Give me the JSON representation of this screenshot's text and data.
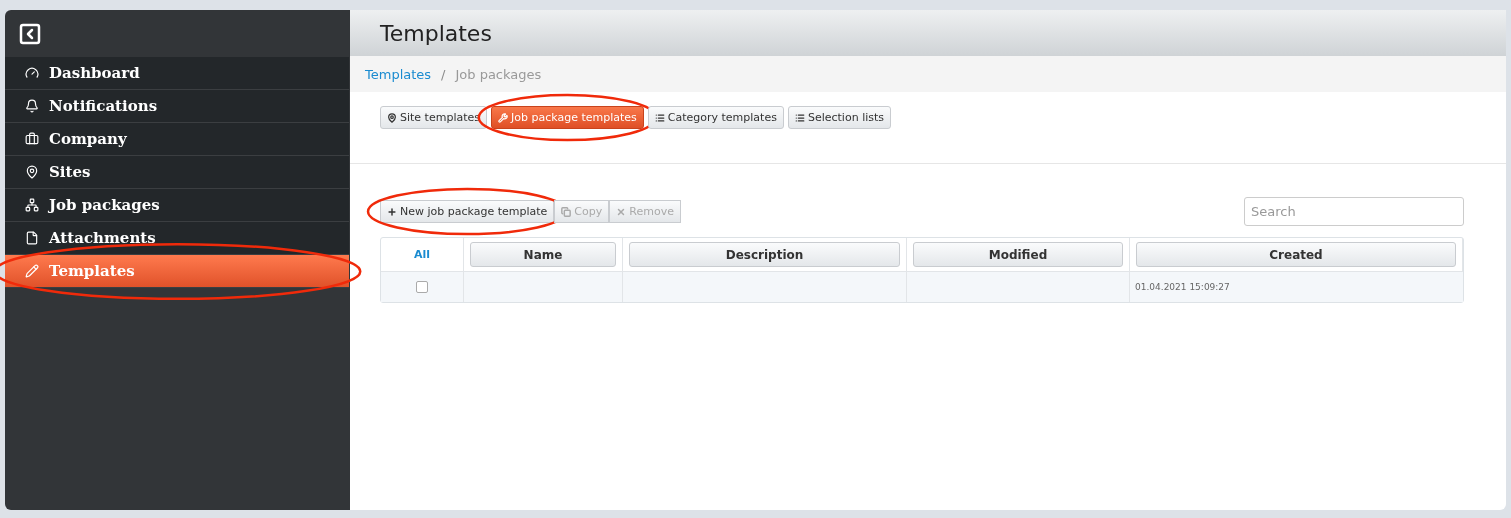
{
  "sidebar": {
    "items": [
      {
        "label": "Dashboard",
        "selected": false,
        "highlighted": false
      },
      {
        "label": "Notifications",
        "selected": false,
        "highlighted": false
      },
      {
        "label": "Company",
        "selected": false,
        "highlighted": false
      },
      {
        "label": "Sites",
        "selected": false,
        "highlighted": false
      },
      {
        "label": "Job packages",
        "selected": false,
        "highlighted": false
      },
      {
        "label": "Attachments",
        "selected": false,
        "highlighted": false
      },
      {
        "label": "Templates",
        "selected": true,
        "highlighted": true
      }
    ]
  },
  "header": {
    "title": "Templates"
  },
  "breadcrumb": [
    {
      "label": "Templates",
      "kind": "link"
    },
    {
      "label": "/",
      "kind": "separator"
    },
    {
      "label": "Job packages",
      "kind": "current"
    }
  ],
  "tabs": [
    {
      "label": "Site templates",
      "selected": false,
      "highlighted": false
    },
    {
      "label": "Job package templates",
      "selected": true,
      "highlighted": true
    },
    {
      "label": "Category templates",
      "selected": false,
      "highlighted": false
    },
    {
      "label": "Selection lists",
      "selected": false,
      "highlighted": false
    }
  ],
  "toolbar": [
    {
      "label": "New job package template",
      "disabled": false,
      "highlighted": true
    },
    {
      "label": "Copy",
      "disabled": true,
      "highlighted": false
    },
    {
      "label": "Remove",
      "disabled": true,
      "highlighted": false
    }
  ],
  "search": {
    "placeholder": "Search"
  },
  "table": {
    "select_all": "All",
    "columns": [
      "Name",
      "Description",
      "Modified",
      "Created"
    ],
    "rows": [
      {
        "checked": false,
        "created": "01.04.2021 15:09:27"
      }
    ]
  }
}
